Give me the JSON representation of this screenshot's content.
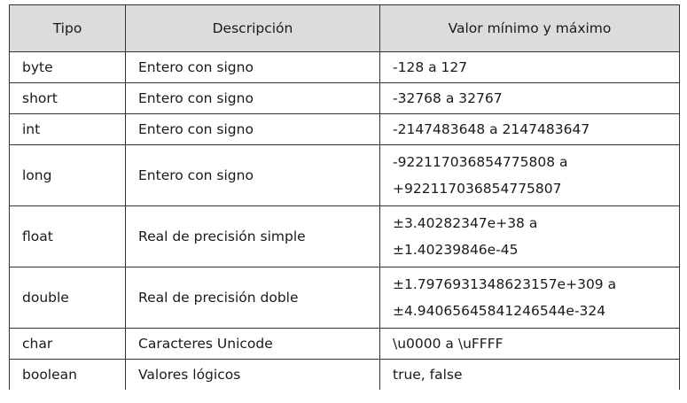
{
  "table": {
    "headers": [
      "Tipo",
      "Descripción",
      "Valor mínimo y máximo"
    ],
    "rows": [
      {
        "tipo": "byte",
        "descripcion": "Entero con signo",
        "rango": [
          "-128 a 127"
        ]
      },
      {
        "tipo": "short",
        "descripcion": "Entero con signo",
        "rango": [
          "-32768 a 32767"
        ]
      },
      {
        "tipo": "int",
        "descripcion": "Entero con signo",
        "rango": [
          "-2147483648 a 2147483647"
        ]
      },
      {
        "tipo": "long",
        "descripcion": "Entero con signo",
        "rango": [
          "-922117036854775808 a",
          "+922117036854775807"
        ]
      },
      {
        "tipo": "float",
        "descripcion": "Real de precisión simple",
        "rango": [
          "±3.40282347e+38 a",
          "±1.40239846e-45"
        ]
      },
      {
        "tipo": "double",
        "descripcion": "Real de precisión doble",
        "rango": [
          "±1.7976931348623157e+309 a",
          "±4.94065645841246544e-324"
        ]
      },
      {
        "tipo": "char",
        "descripcion": "Caracteres Unicode",
        "rango": [
          "\\u0000 a \\uFFFF"
        ]
      },
      {
        "tipo": "boolean",
        "descripcion": "Valores lógicos",
        "rango": [
          "true, false"
        ]
      }
    ]
  }
}
